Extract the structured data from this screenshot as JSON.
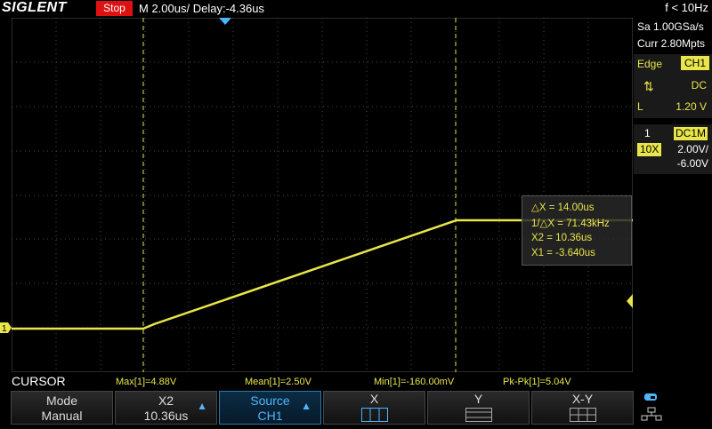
{
  "header": {
    "brand": "SIGLENT",
    "run_state": "Stop",
    "timebase": "M 2.00us/",
    "delay": "Delay:-4.36us",
    "freq": "f < 10Hz"
  },
  "acquisition": {
    "sample_rate": "Sa 1.00GSa/s",
    "memory": "Curr 2.80Mpts"
  },
  "trigger": {
    "type": "Edge",
    "source": "CH1",
    "slope_icon": "rise-fall-slope-icon",
    "coupling": "DC",
    "level_label": "L",
    "level": "1.20 V"
  },
  "channel1": {
    "number": "1",
    "coupling": "DC1M",
    "probe": "10X",
    "vdiv": "2.00V/",
    "offset": "-6.00V"
  },
  "cursor_info": {
    "dx": "△X = 14.00us",
    "inv_dx": "1/△X = 71.43kHz",
    "x2": "X2 = 10.36us",
    "x1": "X1 = -3.640us"
  },
  "measurements": {
    "mode_label": "CURSOR",
    "max": "Max[1]=4.88V",
    "mean": "Mean[1]=2.50V",
    "min": "Min[1]=-160.00mV",
    "pkpk": "Pk-Pk[1]=5.04V"
  },
  "softkeys": {
    "mode": {
      "title": "Mode",
      "value": "Manual"
    },
    "x2": {
      "title": "X2",
      "value": "10.36us"
    },
    "source": {
      "title": "Source",
      "value": "CH1"
    },
    "x": {
      "title": "X"
    },
    "y": {
      "title": "Y"
    },
    "xy": {
      "title": "X-Y"
    }
  },
  "colors": {
    "trace": "#e8e64a",
    "accent": "#4db6ff",
    "stop": "#d11111"
  }
}
